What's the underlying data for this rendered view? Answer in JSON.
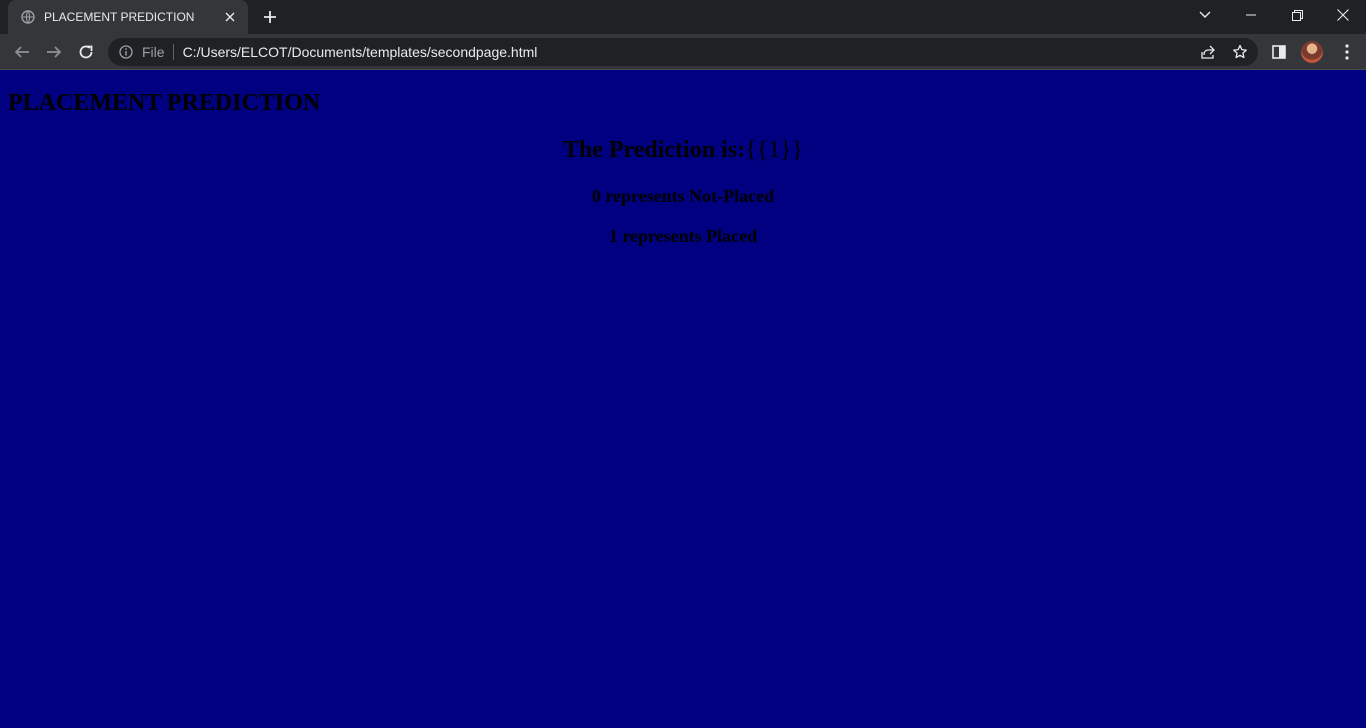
{
  "browser": {
    "tab": {
      "title": "PLACEMENT PREDICTION",
      "favicon": "globe-icon"
    },
    "address_bar": {
      "scheme_label": "File",
      "url": "C:/Users/ELCOT/Documents/templates/secondpage.html"
    }
  },
  "page": {
    "background_color": "#000080",
    "heading": "PLACEMENT PREDICTION",
    "prediction_label": "The Prediction is:",
    "prediction_value": "{{1}}",
    "legend": [
      "0 represents Not-Placed",
      "1 represents Placed"
    ]
  }
}
